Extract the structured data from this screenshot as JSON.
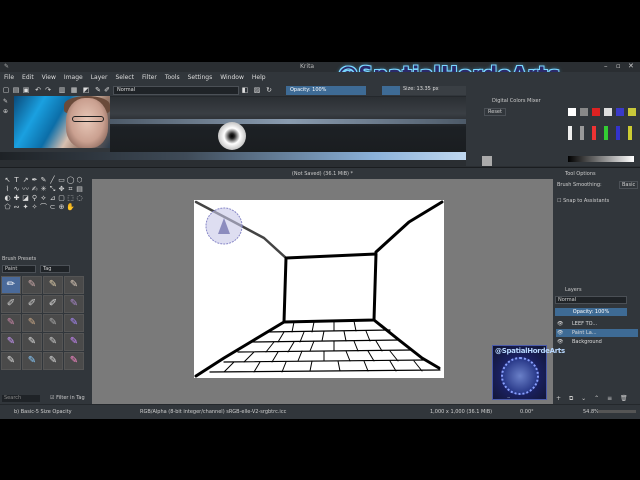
{
  "window": {
    "title": "Krita"
  },
  "watermark": {
    "text": "@SpatialHordeArts"
  },
  "menu": [
    "File",
    "Edit",
    "View",
    "Image",
    "Layer",
    "Select",
    "Filter",
    "Tools",
    "Settings",
    "Window",
    "Help"
  ],
  "toolbar": {
    "blend_mode": "Normal",
    "opacity_label": "Opacity: 100%",
    "size_label": "Size: 13.35 px"
  },
  "digital_colors_mixer": {
    "title": "Digital Colors Mixer",
    "reset_label": "Reset"
  },
  "document": {
    "tab_label": "(Not Saved)  (36.1 MiB) *"
  },
  "tool_options": {
    "title": "Tool Options",
    "smoothing_label": "Brush Smoothing:",
    "smoothing_value": "Basic",
    "snap_label": "Snap to Assistants"
  },
  "brush_presets": {
    "title": "Brush Presets",
    "filter_value": "Paint",
    "tag_value": "Tag"
  },
  "layers": {
    "title": "Layers",
    "blend_mode": "Normal",
    "opacity_label": "Opacity: 100%",
    "items": [
      {
        "name": "LEEF TO..."
      },
      {
        "name": "Paint La..."
      },
      {
        "name": "Background"
      }
    ]
  },
  "status": {
    "brush": "b) Basic-5 Size Opacity",
    "color_space": "RGB/Alpha (8-bit integer/channel)  sRGB-elle-V2-srgbtrc.icc",
    "dimensions": "1,000 x 1,000 (36.1 MiB)",
    "rotation": "0.00°",
    "zoom": "54.8%"
  },
  "search": {
    "placeholder": "Search",
    "filter_in_tag": "Filter in Tag"
  },
  "logo": {
    "text": "@SpatialHordeArts"
  },
  "colors": {
    "accent": "#3e6b95",
    "panel": "#31363b",
    "watermark": "#7ad7ff"
  }
}
